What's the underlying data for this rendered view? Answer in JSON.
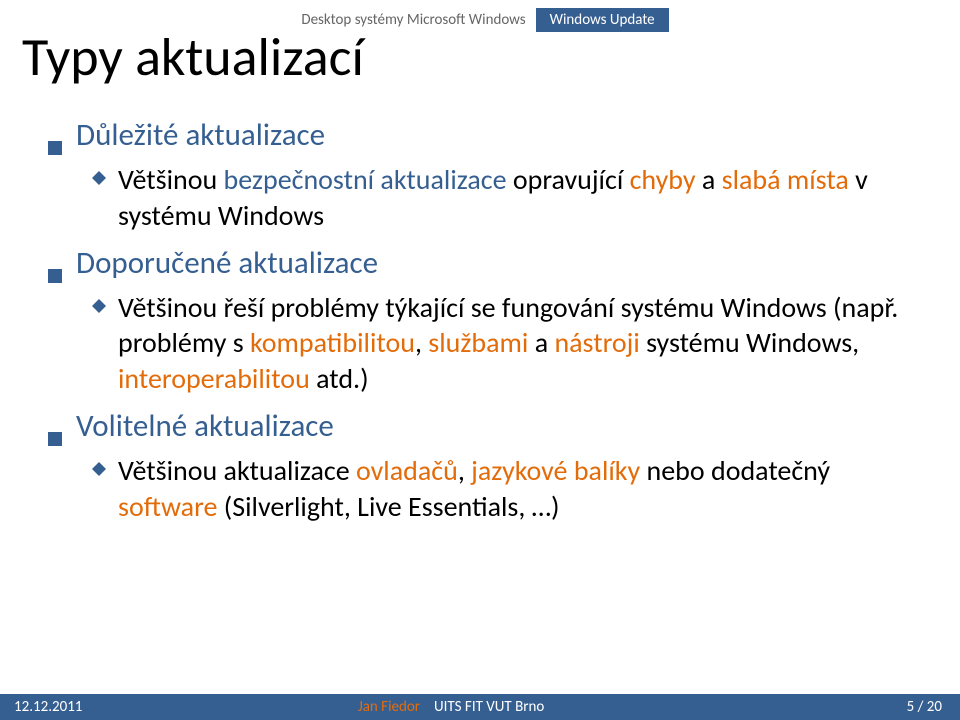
{
  "breadcrumb": {
    "part1": "Desktop systémy Microsoft Windows",
    "part2": "Windows Update"
  },
  "title": "Typy aktualizací",
  "items": [
    {
      "label": "Důležité aktualizace",
      "sub": [
        {
          "runs": [
            {
              "t": "Většinou ",
              "cls": "c"
            },
            {
              "t": "bezpečnostní aktualizace ",
              "cls": "b"
            },
            {
              "t": "opravující ",
              "cls": "c"
            },
            {
              "t": "chyby ",
              "cls": "o"
            },
            {
              "t": "a ",
              "cls": "c"
            },
            {
              "t": "slabá místa ",
              "cls": "o"
            },
            {
              "t": "v systému Windows",
              "cls": "c"
            }
          ]
        }
      ]
    },
    {
      "label": "Doporučené aktualizace",
      "sub": [
        {
          "runs": [
            {
              "t": "Většinou řeší problémy týkající se fungování systému Windows (např. problémy s ",
              "cls": "c"
            },
            {
              "t": "kompatibilitou",
              "cls": "o"
            },
            {
              "t": ", ",
              "cls": "c"
            },
            {
              "t": "službami",
              "cls": "o"
            },
            {
              "t": " a ",
              "cls": "c"
            },
            {
              "t": "nástroji ",
              "cls": "o"
            },
            {
              "t": "systému Windows, ",
              "cls": "c"
            },
            {
              "t": "interoperabilitou ",
              "cls": "o"
            },
            {
              "t": "atd.)",
              "cls": "c"
            }
          ]
        }
      ]
    },
    {
      "label": "Volitelné aktualizace",
      "sub": [
        {
          "runs": [
            {
              "t": "Většinou aktualizace ",
              "cls": "c"
            },
            {
              "t": "ovladačů",
              "cls": "o"
            },
            {
              "t": ", ",
              "cls": "c"
            },
            {
              "t": "jazykové balíky ",
              "cls": "o"
            },
            {
              "t": "nebo dodatečný ",
              "cls": "c"
            },
            {
              "t": "software ",
              "cls": "o"
            },
            {
              "t": "(Silverlight, Live Essentials, …)",
              "cls": "c"
            }
          ]
        }
      ]
    }
  ],
  "footer": {
    "date": "12.12.2011",
    "author": "Jan Fiedor",
    "org": "UITS FIT VUT Brno",
    "page": "5 / 20"
  }
}
